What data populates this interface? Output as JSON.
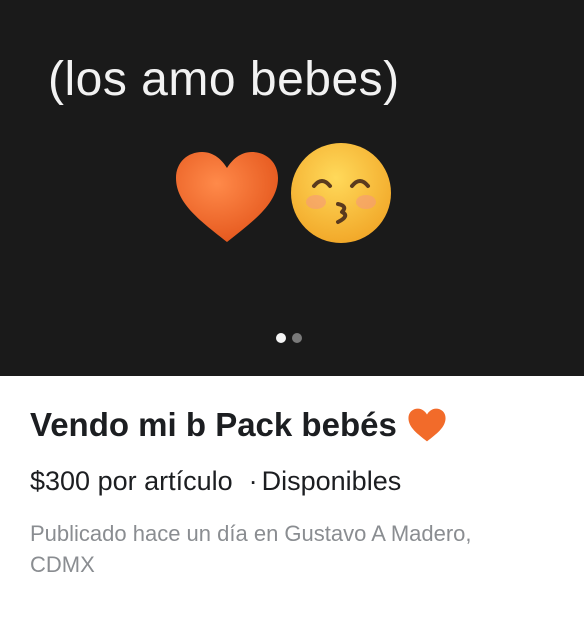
{
  "photo": {
    "caption": "(los amo bebes)",
    "emojis": [
      "orange-heart-icon",
      "kissing-face-smiling-eyes-icon"
    ],
    "carousel": {
      "total": 2,
      "active": 1
    },
    "background": "#1a1a1a"
  },
  "listing": {
    "title": "Vendo mi b Pack bebés",
    "title_icon": "orange-heart-icon",
    "price": "$300 por artículo",
    "separator": "·",
    "availability": "Disponibles",
    "meta": "Publicado hace un día en Gustavo A Madero, CDMX"
  },
  "colors": {
    "heart": "#f26b2a",
    "emoji_face": "#f7c23a",
    "title": "#1c1e21",
    "meta": "#8a8d91"
  }
}
